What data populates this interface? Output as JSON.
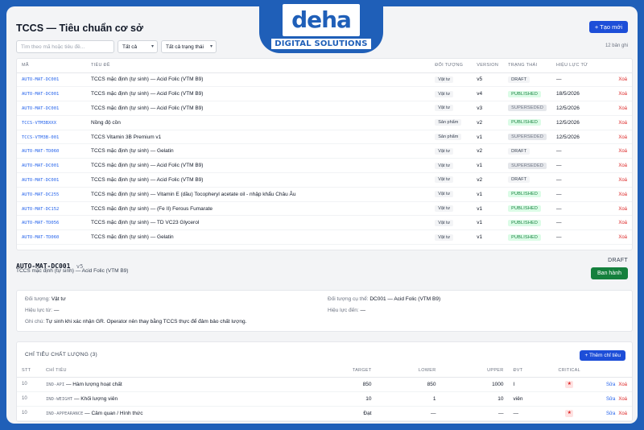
{
  "logo": {
    "mark": "deha",
    "sub": "DIGITAL SOLUTIONS"
  },
  "header": {
    "title": "TCCS — Tiêu chuẩn cơ sở",
    "create_label": "+ Tạo mới"
  },
  "filters": {
    "search_placeholder": "Tìm theo mã hoặc tiêu đề...",
    "type_select": "Tất cả",
    "status_select": "Tất cả trạng thái",
    "count_text": "12 bản ghi"
  },
  "table": {
    "columns": [
      "Mã",
      "Tiêu đề",
      "Đối tượng",
      "Version",
      "Trạng thái",
      "Hiệu lực từ",
      ""
    ],
    "delete_label": "Xoá",
    "rows": [
      {
        "code": "AUTO-MAT-DC001",
        "title": "TCCS mặc định (tự sinh) — Acid Folic (VTM B9)",
        "object": "Vật tư",
        "version": "v5",
        "status": "DRAFT",
        "status_class": "st-draft",
        "effective": "—"
      },
      {
        "code": "AUTO-MAT-DC001",
        "title": "TCCS mặc định (tự sinh) — Acid Folic (VTM B9)",
        "object": "Vật tư",
        "version": "v4",
        "status": "PUBLISHED",
        "status_class": "st-published",
        "effective": "18/5/2026"
      },
      {
        "code": "AUTO-MAT-DC001",
        "title": "TCCS mặc định (tự sinh) — Acid Folic (VTM B9)",
        "object": "Vật tư",
        "version": "v3",
        "status": "SUPERSEDED",
        "status_class": "st-superseded",
        "effective": "12/5/2026"
      },
      {
        "code": "TCCS-VTM3BXXX",
        "title": "Nồng độ cồn",
        "object": "Sản phẩm",
        "version": "v2",
        "status": "PUBLISHED",
        "status_class": "st-published",
        "effective": "12/5/2026"
      },
      {
        "code": "TCCS-VTM3B-001",
        "title": "TCCS Vitamin 3B Premium v1",
        "object": "Sản phẩm",
        "version": "v1",
        "status": "SUPERSEDED",
        "status_class": "st-superseded",
        "effective": "12/5/2026"
      },
      {
        "code": "AUTO-MAT-TD060",
        "title": "TCCS mặc định (tự sinh) — Gelatin",
        "object": "Vật tư",
        "version": "v2",
        "status": "DRAFT",
        "status_class": "st-draft",
        "effective": "—"
      },
      {
        "code": "AUTO-MAT-DC001",
        "title": "TCCS mặc định (tự sinh) — Acid Folic (VTM B9)",
        "object": "Vật tư",
        "version": "v1",
        "status": "SUPERSEDED",
        "status_class": "st-superseded",
        "effective": "—"
      },
      {
        "code": "AUTO-MAT-DC001",
        "title": "TCCS mặc định (tự sinh) — Acid Folic (VTM B9)",
        "object": "Vật tư",
        "version": "v2",
        "status": "DRAFT",
        "status_class": "st-draft",
        "effective": "—"
      },
      {
        "code": "AUTO-MAT-DC255",
        "title": "TCCS mặc định (tự sinh) — Vitamin E (dầu) Tocopheryl acetate oil - nhập khẩu Châu Âu",
        "object": "Vật tư",
        "version": "v1",
        "status": "PUBLISHED",
        "status_class": "st-published",
        "effective": "—"
      },
      {
        "code": "AUTO-MAT-DC152",
        "title": "TCCS mặc định (tự sinh) — (Fe II) Ferous Fumarate",
        "object": "Vật tư",
        "version": "v1",
        "status": "PUBLISHED",
        "status_class": "st-published",
        "effective": "—"
      },
      {
        "code": "AUTO-MAT-TD056",
        "title": "TCCS mặc định (tự sinh) — TD VC23 Glycerol",
        "object": "Vật tư",
        "version": "v1",
        "status": "PUBLISHED",
        "status_class": "st-published",
        "effective": "—"
      },
      {
        "code": "AUTO-MAT-TD060",
        "title": "TCCS mặc định (tự sinh) — Gelatin",
        "object": "Vật tư",
        "version": "v1",
        "status": "PUBLISHED",
        "status_class": "st-published",
        "effective": "—"
      }
    ]
  },
  "detail": {
    "code": "AUTO-MAT-DC001",
    "version": "v5",
    "name": "TCCS mặc định (tự sinh) — Acid Folic (VTM B9)",
    "status": "DRAFT",
    "publish_label": "Ban hành",
    "object_label": "Đối tượng:",
    "object_value": "Vật tư",
    "specific_label": "Đối tượng cụ thể:",
    "specific_value": "DC001 — Acid Folic (VTM B9)",
    "from_label": "Hiệu lực từ:",
    "from_value": "—",
    "to_label": "Hiệu lực đến:",
    "to_value": "—",
    "note_label": "Ghi chú:",
    "note_value": "Tự sinh khi xác nhận GR. Operator nên thay bằng TCCS thực để đảm bảo chất lượng."
  },
  "metrics": {
    "title": "Chỉ tiêu chất lượng (3)",
    "add_label": "+ Thêm chỉ tiêu",
    "columns": [
      "STT",
      "Chỉ tiêu",
      "Target",
      "Lower",
      "Upper",
      "ĐVT",
      "Critical",
      ""
    ],
    "edit_label": "Sửa",
    "delete_label": "Xoá",
    "rows": [
      {
        "stt": "10",
        "code": "IND-API",
        "name": "— Hàm lượng hoạt chất",
        "target": "850",
        "lower": "850",
        "upper": "1000",
        "unit": "I",
        "critical": true
      },
      {
        "stt": "10",
        "code": "IND-WEIGHT",
        "name": "— Khối lượng viên",
        "target": "10",
        "lower": "1",
        "upper": "10",
        "unit": "viên",
        "critical": false
      },
      {
        "stt": "10",
        "code": "IND-APPEARANCE",
        "name": "— Cảm quan / Hình thức",
        "target": "Đạt",
        "lower": "—",
        "upper": "—",
        "unit": "—",
        "critical": true
      }
    ]
  },
  "colors": {
    "brand": "#1f5fb8",
    "primary": "#1d4ed8",
    "publish": "#15803d",
    "danger": "#dc2626"
  },
  "icons": {
    "critical": "star-icon",
    "dropdown": "chevron-down-icon"
  }
}
